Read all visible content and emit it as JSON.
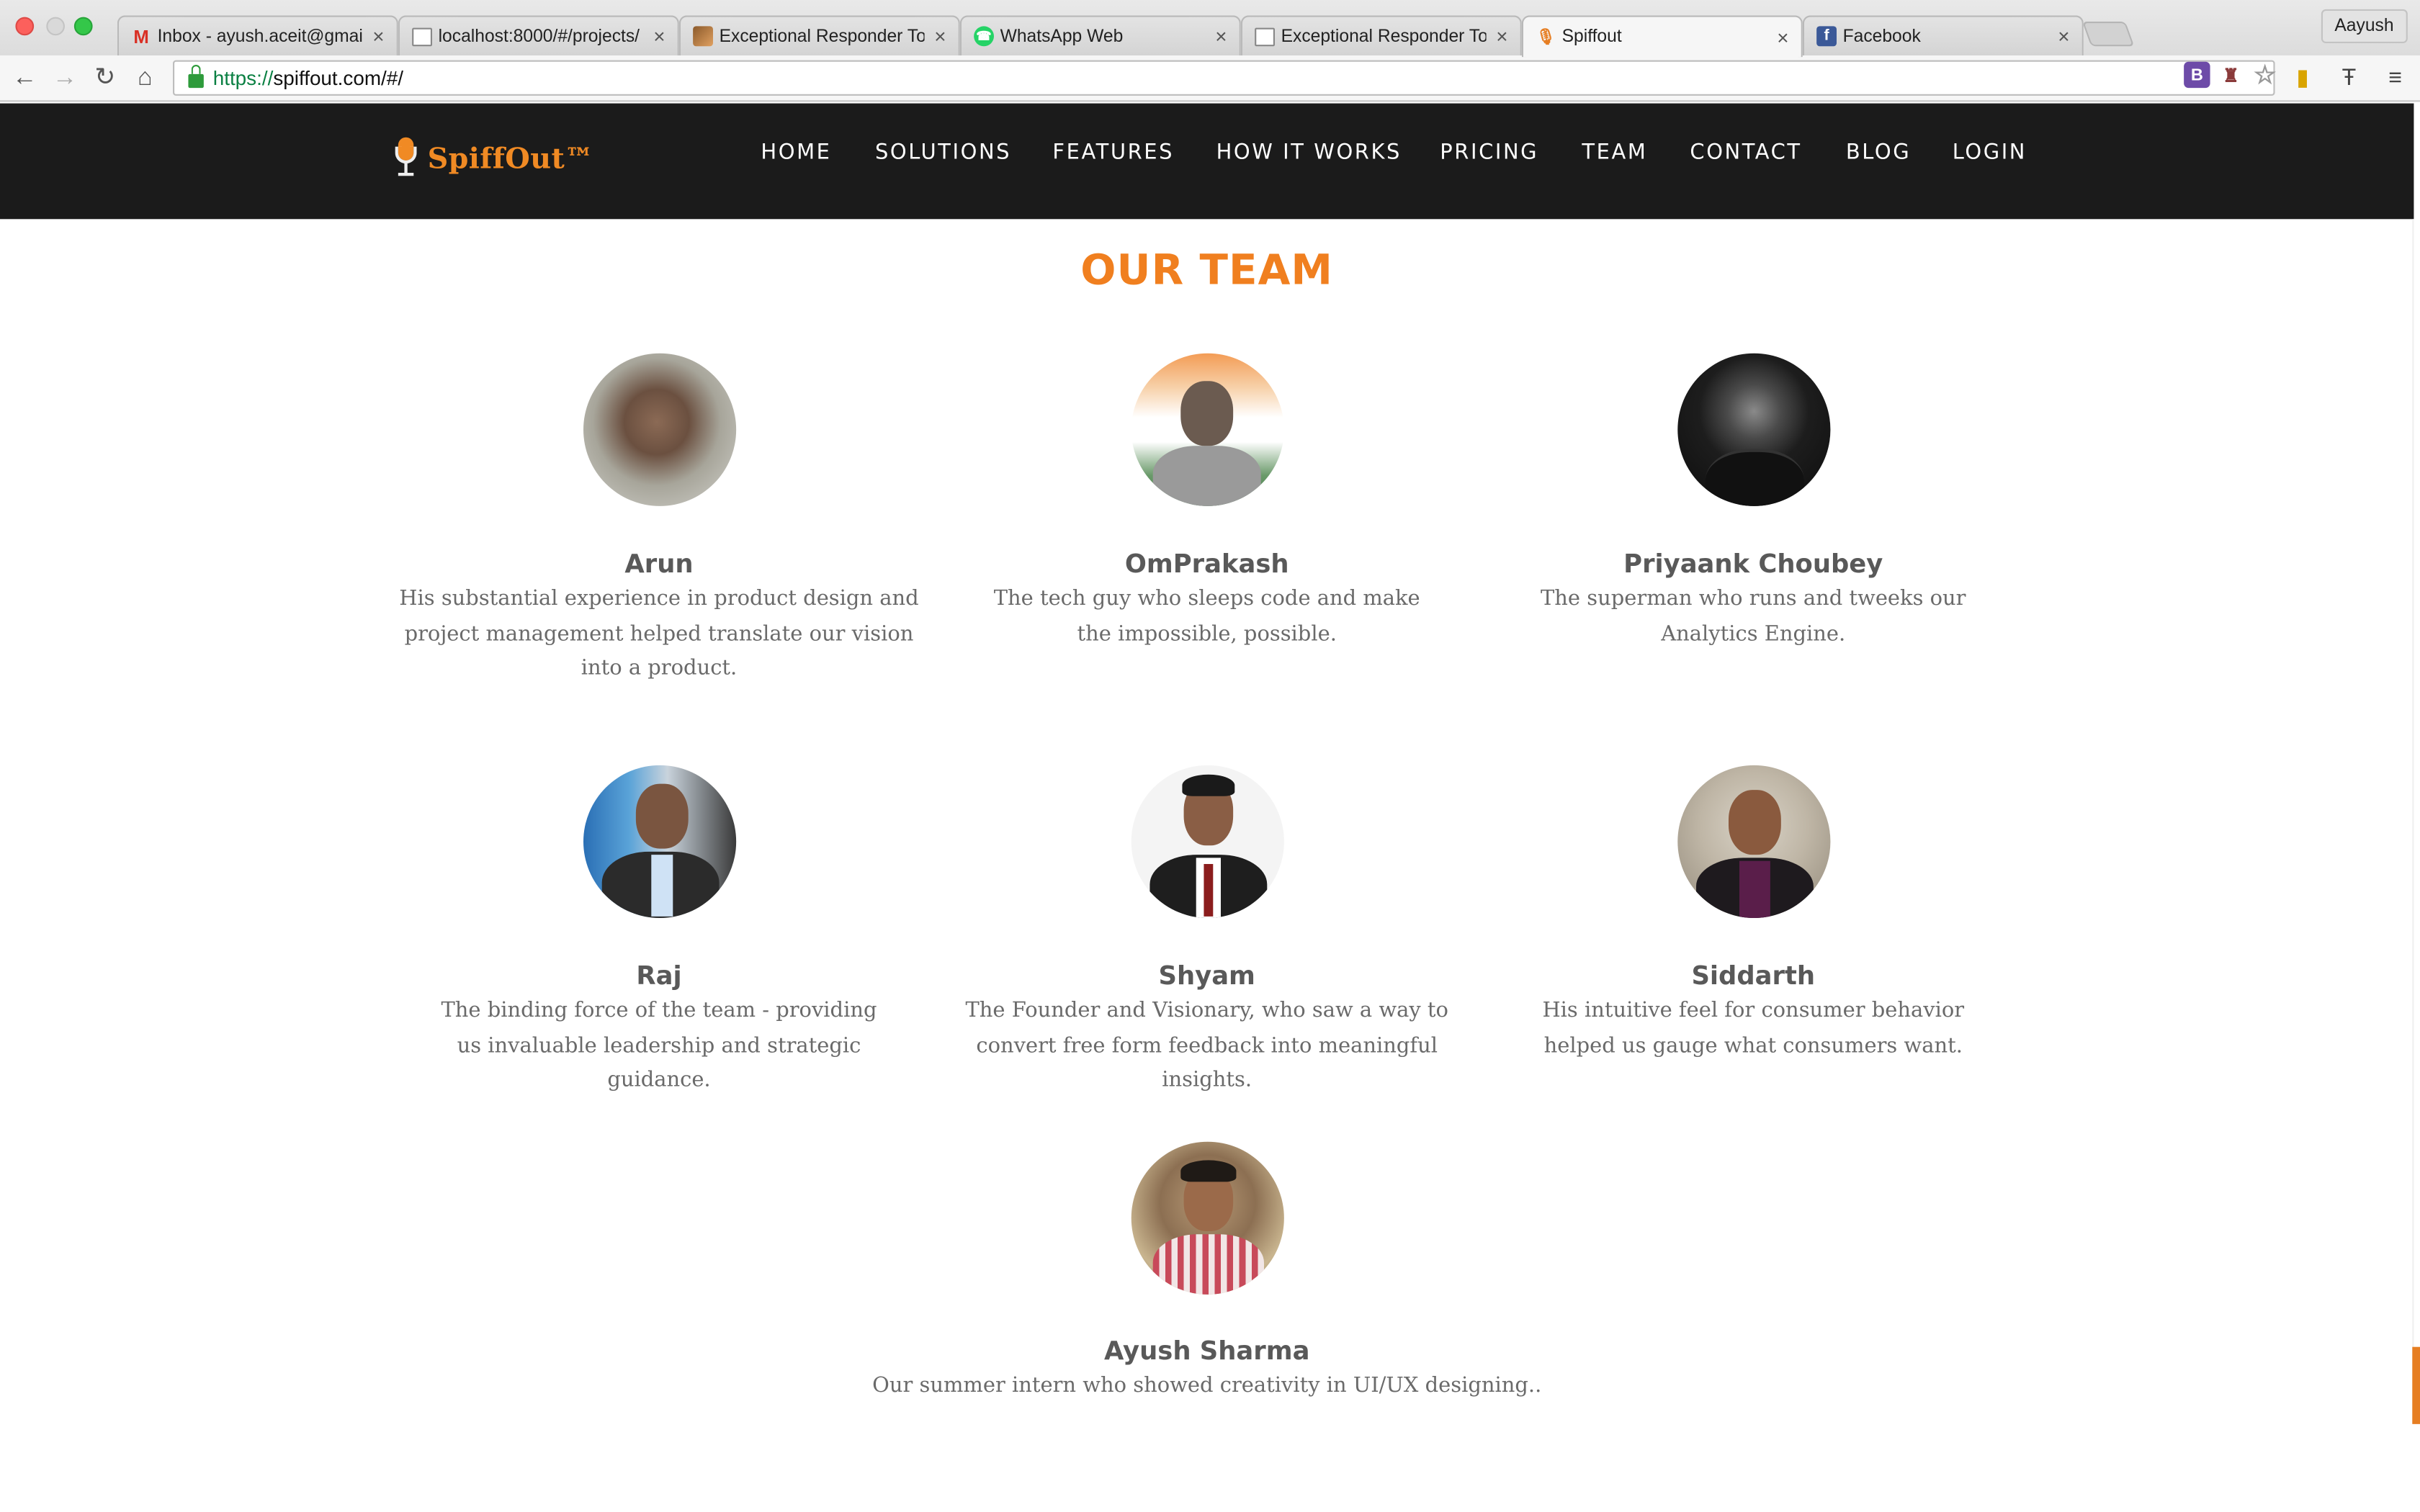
{
  "browser": {
    "tabs": [
      {
        "label": "Inbox - ayush.aceit@gmail.",
        "icon": "gmail-icon"
      },
      {
        "label": "localhost:8000/#/projects/",
        "icon": "document-icon"
      },
      {
        "label": "Exceptional Responder Too",
        "icon": "responder-icon"
      },
      {
        "label": "WhatsApp Web",
        "icon": "whatsapp-icon"
      },
      {
        "label": "Exceptional Responder Too",
        "icon": "document-icon"
      },
      {
        "label": "Spiffout",
        "icon": "microphone-icon",
        "active": true
      },
      {
        "label": "Facebook",
        "icon": "facebook-icon"
      }
    ],
    "close_glyph": "×",
    "profile_name": "Aayush",
    "url_scheme": "https://",
    "url_rest": "spiffout.com/#/"
  },
  "site": {
    "logo_text": "SpiffOut™",
    "nav": [
      "HOME",
      "SOLUTIONS",
      "FEATURES",
      "HOW IT WORKS",
      "PRICING",
      "TEAM",
      "CONTACT",
      "BLOG",
      "LOGIN"
    ],
    "accent_color": "#f07f1f",
    "nav_background": "#1b1b1b"
  },
  "team": {
    "title": "OUR TEAM",
    "members": [
      {
        "name": "Arun",
        "description": "His substantial experience in product design and project management helped translate our vision into a product."
      },
      {
        "name": "OmPrakash",
        "description": "The tech guy who sleeps code and make the impossible, possible."
      },
      {
        "name": "Priyaank Choubey",
        "description": "The superman who runs and tweeks our Analytics Engine."
      },
      {
        "name": "Raj",
        "description": "The binding force of the team - providing us invaluable leadership and strategic guidance."
      },
      {
        "name": "Shyam",
        "description": "The Founder and Visionary, who saw a way to convert free form feedback into meaningful insights."
      },
      {
        "name": "Siddarth",
        "description": "His intuitive feel for consumer behavior helped us gauge what consumers want."
      },
      {
        "name": "Ayush Sharma",
        "description": "Our summer intern who showed creativity in UI/UX designing.."
      }
    ]
  }
}
